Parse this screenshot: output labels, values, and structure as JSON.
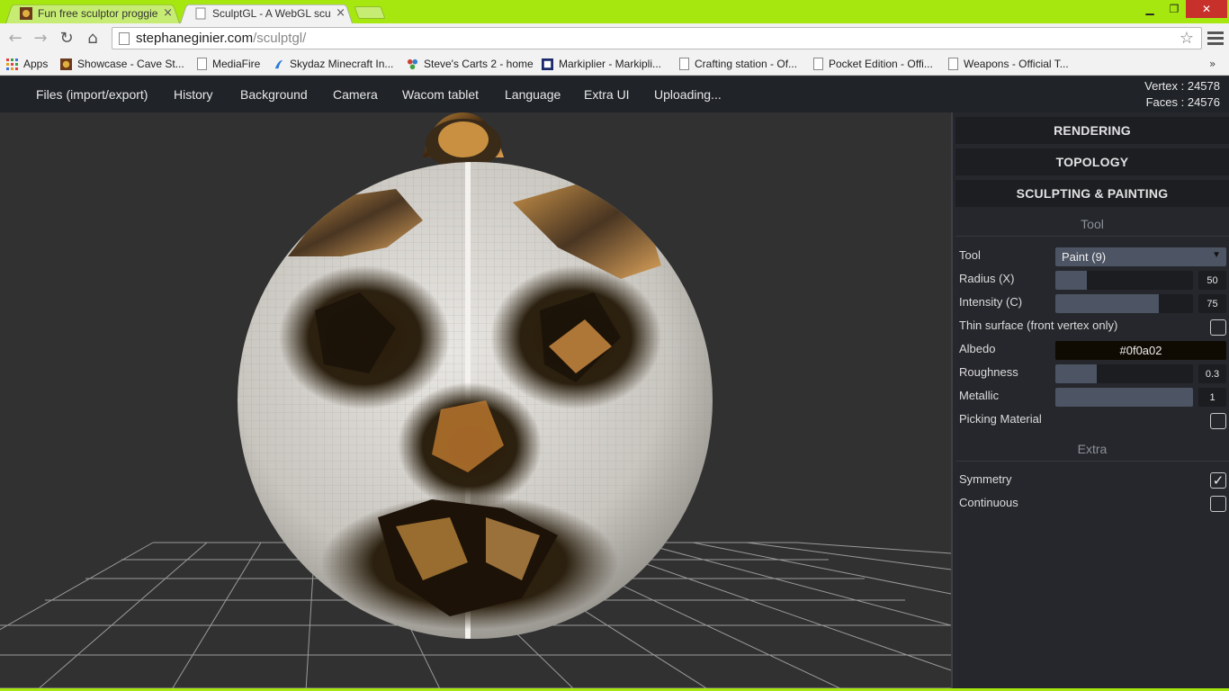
{
  "browser": {
    "tabs": [
      {
        "title": "Fun free sculptor proggie",
        "close": "×"
      },
      {
        "title": "SculptGL - A WebGL sculpt",
        "close": "×"
      }
    ],
    "window_controls": {
      "minimize": "▁",
      "maximize": "❐",
      "close": "✕"
    },
    "url_host": "stephaneginier.com",
    "url_path": "/sculptgl/",
    "bookmarks": [
      {
        "label": "Apps",
        "icon": "apps-grid-icon"
      },
      {
        "label": "Showcase - Cave St...",
        "icon": "site-favicon"
      },
      {
        "label": "MediaFire",
        "icon": "page-icon"
      },
      {
        "label": "Skydaz  Minecraft In...",
        "icon": "skydaz-icon"
      },
      {
        "label": "Steve's Carts 2 - home",
        "icon": "puzzle-icon"
      },
      {
        "label": "Markiplier - Markipli...",
        "icon": "markiplier-icon"
      },
      {
        "label": "Crafting station - Of...",
        "icon": "page-icon"
      },
      {
        "label": "Pocket Edition - Offi...",
        "icon": "page-icon"
      },
      {
        "label": "Weapons - Official T...",
        "icon": "page-icon"
      }
    ],
    "bookmarks_overflow": "»"
  },
  "app": {
    "menu": [
      "Files (import/export)",
      "History",
      "Background",
      "Camera",
      "Wacom tablet",
      "Language",
      "Extra UI",
      "Uploading..."
    ],
    "stats": {
      "vertex": "Vertex : 24578",
      "faces": "Faces : 24576"
    }
  },
  "panel": {
    "sections": {
      "rendering": "RENDERING",
      "topology": "TOPOLOGY",
      "sculpting": "SCULPTING & PAINTING"
    },
    "tool_header": "Tool",
    "tool_label": "Tool",
    "tool_value": "Paint (9)",
    "radius": {
      "label": "Radius (X)",
      "value": "50",
      "fraction": 0.23
    },
    "intensity": {
      "label": "Intensity (C)",
      "value": "75",
      "fraction": 0.75
    },
    "thin_surface": {
      "label": "Thin surface (front vertex only)",
      "checked": false
    },
    "albedo": {
      "label": "Albedo",
      "value": "#0f0a02",
      "color": "#0f0a02"
    },
    "roughness": {
      "label": "Roughness",
      "value": "0.3",
      "fraction": 0.3
    },
    "metallic": {
      "label": "Metallic",
      "value": "1",
      "fraction": 1.0
    },
    "picking_material": {
      "label": "Picking Material",
      "checked": false
    },
    "extra_header": "Extra",
    "symmetry": {
      "label": "Symmetry",
      "checked": true,
      "mark": "✓"
    },
    "continuous": {
      "label": "Continuous",
      "checked": false
    }
  },
  "colors": {
    "chrome_frame": "#a6e70f",
    "menu_bar": "#202328",
    "panel_bg": "#25272c",
    "slider_fill": "#4d5564",
    "viewport_bg": "#313131"
  }
}
